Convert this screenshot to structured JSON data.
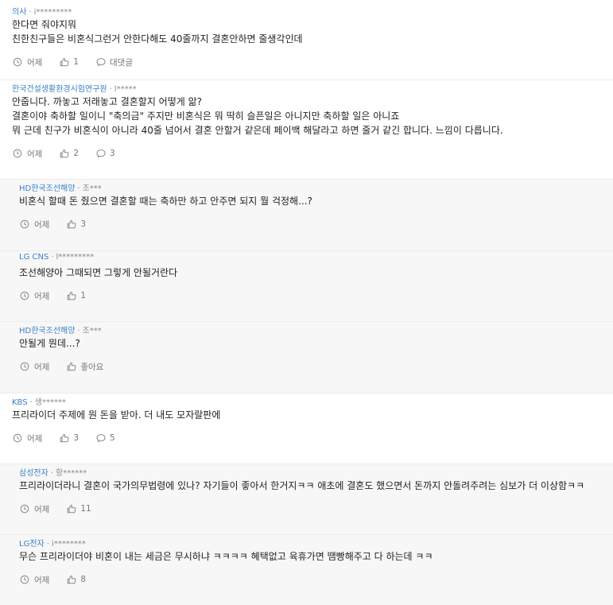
{
  "comments": [
    {
      "company": "의사",
      "user": "i*********",
      "reply": false,
      "lines": [
        "한다면 줘야지뭐",
        "친한친구들은 비혼식그런거 안한다해도 40줄까지 결혼안하면 줄생각인데"
      ],
      "time": "어제",
      "likes": "1",
      "replies_label": "대댓글"
    },
    {
      "company": "한국건설생활환경시험연구원",
      "user": "l*****",
      "reply": false,
      "lines": [
        "안줍니다. 까놓고 저래놓고 결혼할지 어떻게 앎?",
        "결혼이야 축하할 일이니 \"축의금\" 주지만 비혼식은 뭐 딱히 슬픈일은 아니지만 축하할 일은 아니죠",
        "뭐 근데 친구가 비혼식이 아니라 40줄 넘어서 결혼 안할거 같은데 페이백 해달라고 하면 줄거 같긴 합니다. 느낌이 다릅니다."
      ],
      "time": "어제",
      "likes": "2",
      "replies_label": "3"
    },
    {
      "company": "HD한국조선해양",
      "user": "조***",
      "reply": true,
      "lines": [
        "비혼식 할때 돈 줬으면 결혼할 때는 축하만 하고 안주면 되지 뭘 걱정해...?"
      ],
      "time": "어제",
      "likes": "3",
      "replies_label": null
    },
    {
      "company": "LG CNS",
      "user": "l*********",
      "reply": true,
      "lines": [
        "조선해양아 그때되면 그렇게 안될거란다"
      ],
      "time": "어제",
      "likes": "1",
      "replies_label": null
    },
    {
      "company": "HD한국조선해양",
      "user": "조***",
      "reply": true,
      "lines": [
        "안될게 뭔데...?"
      ],
      "time": "어제",
      "likes": "좋아요",
      "replies_label": null
    },
    {
      "company": "KBS",
      "user": "생******",
      "reply": false,
      "lines": [
        "프리라이더 주제에 뭔 돈을 받아. 더 내도 모자랄판에"
      ],
      "time": "어제",
      "likes": "3",
      "replies_label": "5"
    },
    {
      "company": "삼성전자",
      "user": "항******",
      "reply": true,
      "lines": [
        "프리라이더라니 결혼이 국가의무법령에 있나? 자기들이 좋아서 한거지ㅋㅋ 애초에 결혼도 했으면서 돈까지 안돌려주려는 심보가 더 이상함ㅋㅋ"
      ],
      "time": "어제",
      "likes": "11",
      "replies_label": null
    },
    {
      "company": "LG전자",
      "user": "i********",
      "reply": true,
      "lines": [
        "무슨 프리라이더야 비혼이 내는 세금은 무시하냐 ㅋㅋㅋㅋ 혜택없고 육휴가면 땜빵해주고 다 하는데 ㅋㅋ"
      ],
      "time": "어제",
      "likes": "8",
      "replies_label": null
    }
  ],
  "ui": {
    "dot": "·"
  },
  "colors": {
    "company": "#3b7fc4",
    "reply_bg": "#f7f7f8",
    "meta": "#888888",
    "divider": "#ececec"
  },
  "icons": {
    "time": "clock-icon",
    "like": "thumbs-up-icon",
    "reply": "comment-icon"
  }
}
